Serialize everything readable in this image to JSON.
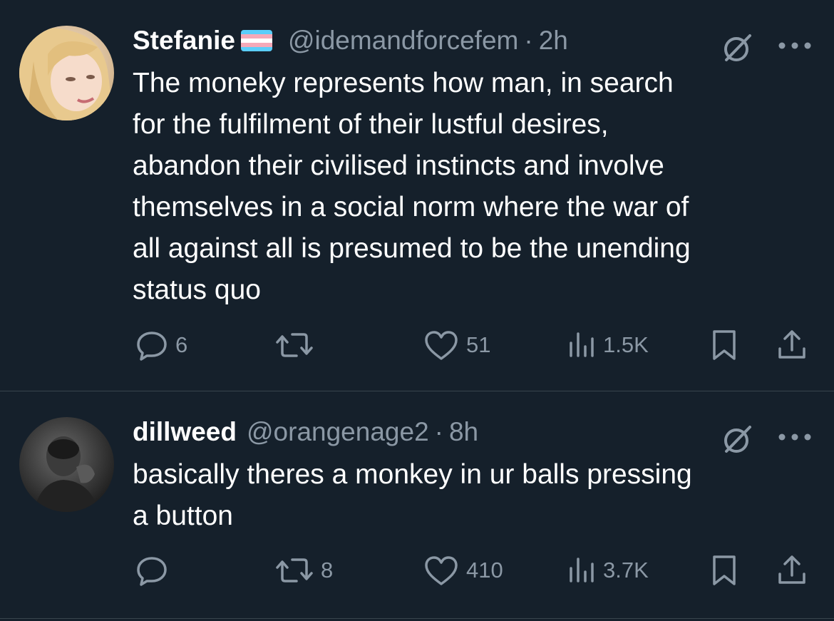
{
  "tweets": [
    {
      "display_name": "Stefanie",
      "handle": "@idemandforcefem",
      "separator": "·",
      "time": "2h",
      "text": "The moneky represents how man, in search\nfor the fulfilment of their lustful desires,\nabandon their civilised instincts and involve\nthemselves in a social norm where the war of\nall against all is presumed to be the unending\nstatus quo",
      "replies": "6",
      "retweets": "",
      "likes": "51",
      "views": "1.5K",
      "icons": [
        "reply-icon",
        "retweet-icon",
        "like-icon",
        "views-icon",
        "bookmark-icon",
        "share-icon",
        "grok-icon",
        "more-icon",
        "trans-flag-icon"
      ]
    },
    {
      "display_name": "dillweed",
      "handle": "@orangenage2",
      "separator": "·",
      "time": "8h",
      "text": "basically theres a monkey in ur balls pressing\na button",
      "replies": "",
      "retweets": "8",
      "likes": "410",
      "views": "3.7K",
      "icons": [
        "reply-icon",
        "retweet-icon",
        "like-icon",
        "views-icon",
        "bookmark-icon",
        "share-icon",
        "grok-icon",
        "more-icon"
      ]
    }
  ],
  "colors": {
    "background": "#15202b",
    "text": "#ffffff",
    "secondary_text": "#8b98a5",
    "divider": "#38444d"
  }
}
